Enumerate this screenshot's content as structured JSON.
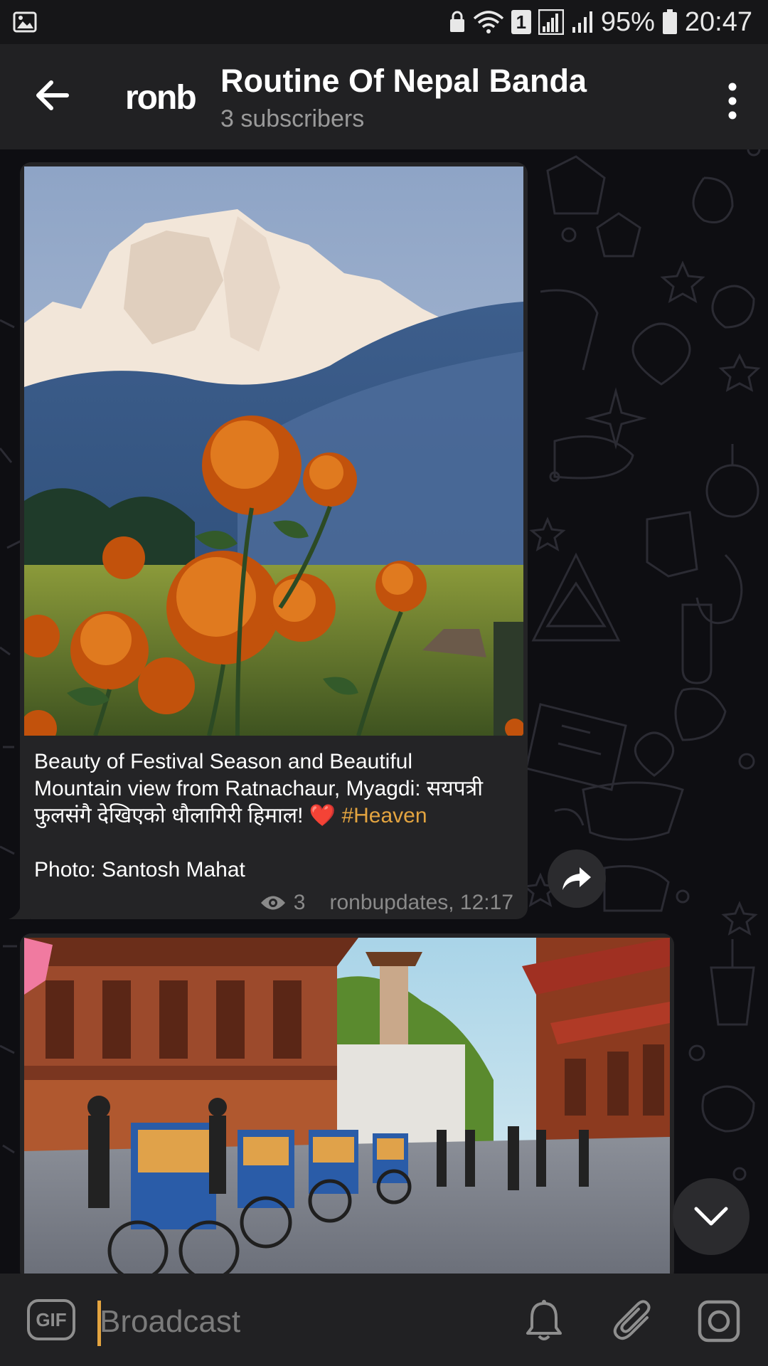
{
  "status_bar": {
    "sim_badge": "1",
    "battery": "95%",
    "time": "20:47"
  },
  "header": {
    "logo_text": "ronb",
    "title": "Routine Of Nepal Banda",
    "subtitle": "3 subscribers"
  },
  "messages": [
    {
      "caption_line1": "Beauty of Festival Season and Beautiful",
      "caption_line2": "Mountain view from Ratnachaur, Myagdi: सयपत्री",
      "caption_line3": "फुलसंगै देखिएको धौलागिरी हिमाल!",
      "caption_emoji": "❤️",
      "hashtag": "#Heaven",
      "credit": "Photo: Santosh Mahat",
      "views": "3",
      "author_time": "ronbupdates, 12:17"
    }
  ],
  "composer": {
    "gif_label": "GIF",
    "placeholder": "Broadcast"
  },
  "icons": {
    "gallery": "image-icon",
    "wifi": "wifi-icon",
    "signal": "signal-icon",
    "battery": "battery-icon",
    "back": "arrow-left-icon",
    "more": "more-vertical-icon",
    "share": "share-icon",
    "views": "eye-icon",
    "scroll": "chevron-down-icon",
    "bell": "bell-icon",
    "attach": "paperclip-icon",
    "camera": "camera-icon"
  },
  "colors": {
    "accent": "#e3a440",
    "header_bg": "#212123",
    "bubble_bg": "#242426",
    "chat_bg": "#0e0e12"
  }
}
